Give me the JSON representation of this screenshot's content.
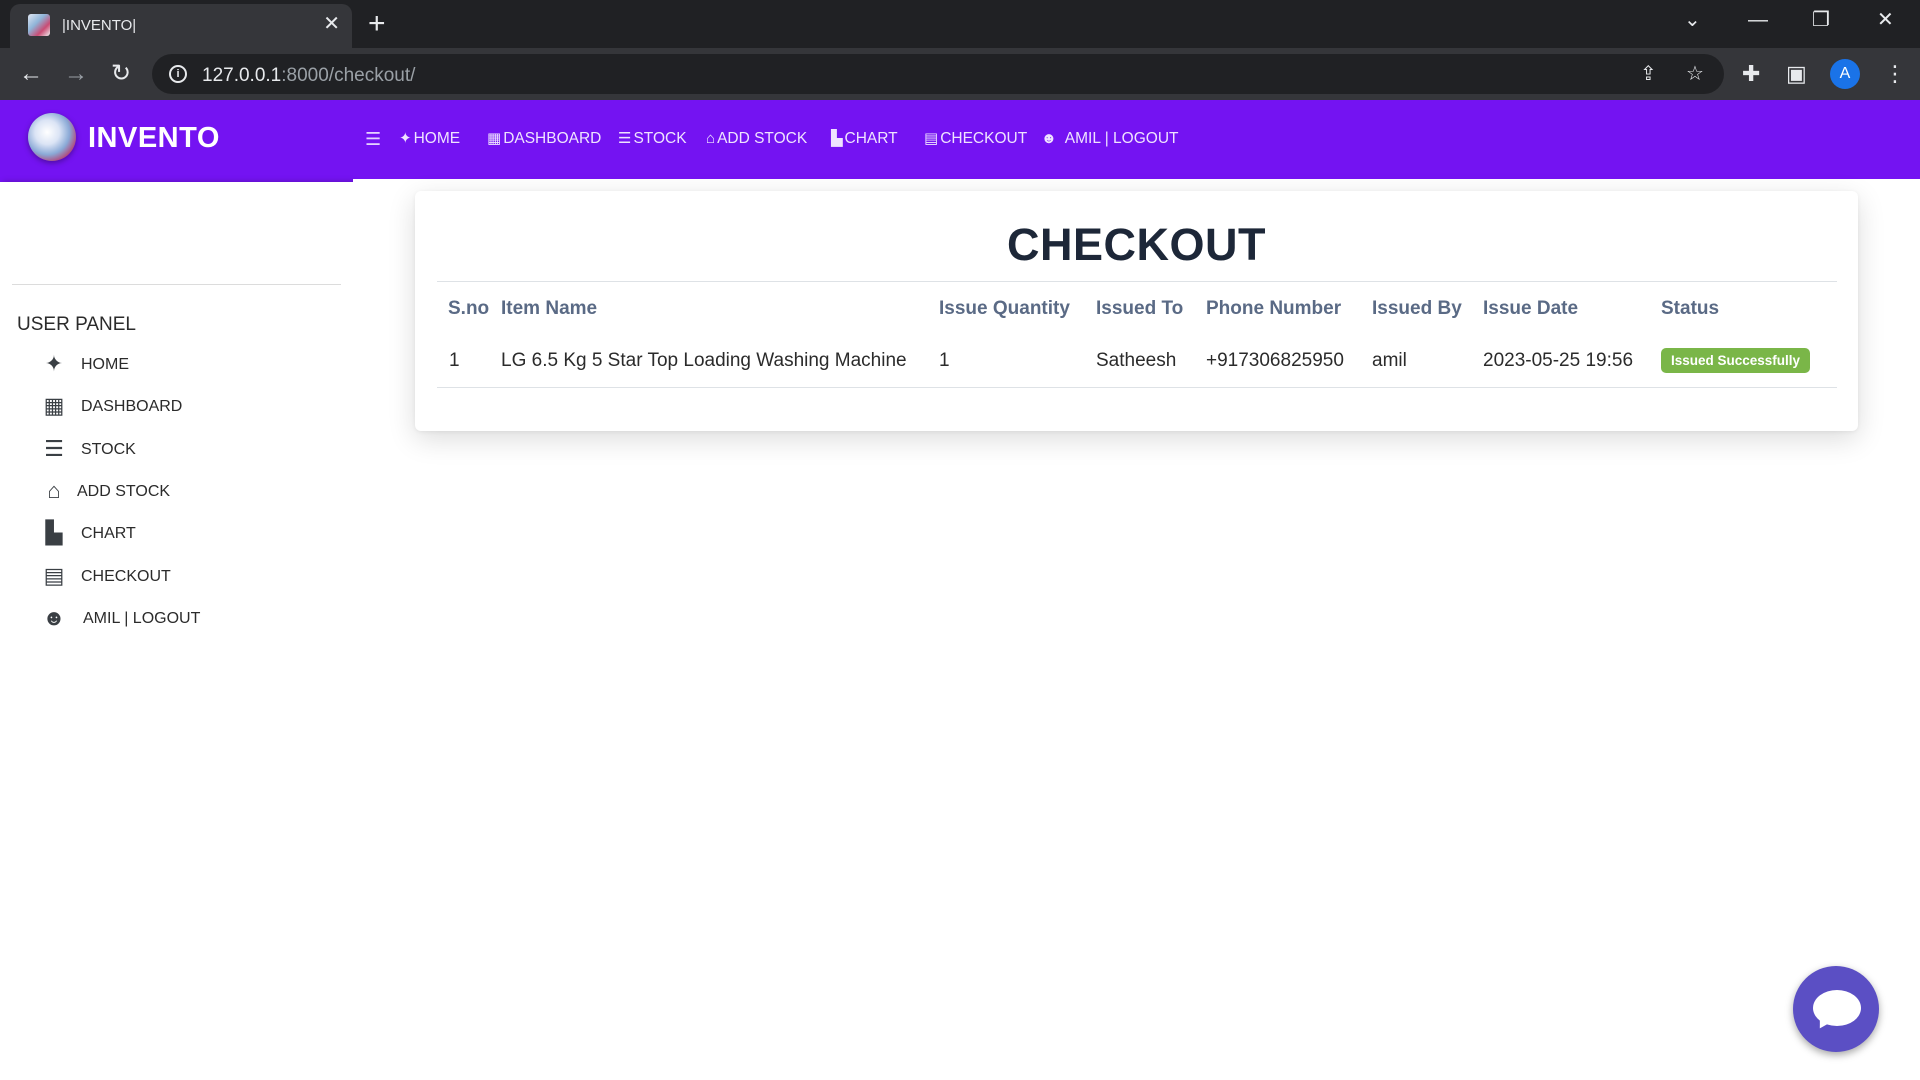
{
  "browser": {
    "tab_title": "|INVENTO|",
    "tab_close": "✕",
    "new_tab": "+",
    "url_host": "127.0.0.1",
    "url_rest": ":8000/checkout/",
    "profile_initial": "A"
  },
  "brand": {
    "name": "INVENTO",
    "color": "#7413f2"
  },
  "topnav": {
    "items": [
      {
        "label": "HOME",
        "icon": "puzzle-icon"
      },
      {
        "label": "DASHBOARD",
        "icon": "grid-icon"
      },
      {
        "label": "STOCK",
        "icon": "database-icon"
      },
      {
        "label": "ADD STOCK",
        "icon": "warehouse-icon"
      },
      {
        "label": "CHART",
        "icon": "chart-icon"
      },
      {
        "label": "CHECKOUT",
        "icon": "box-icon"
      },
      {
        "label": "AMIL | LOGOUT",
        "icon": "users-icon"
      }
    ]
  },
  "sidebar": {
    "panel_title": "USER PANEL",
    "items": [
      {
        "label": "HOME",
        "icon": "puzzle-icon"
      },
      {
        "label": "DASHBOARD",
        "icon": "grid-icon"
      },
      {
        "label": "STOCK",
        "icon": "database-icon"
      },
      {
        "label": "ADD STOCK",
        "icon": "warehouse-icon"
      },
      {
        "label": "CHART",
        "icon": "chart-icon"
      },
      {
        "label": "CHECKOUT",
        "icon": "box-icon"
      },
      {
        "label": "AMIL | LOGOUT",
        "icon": "users-icon"
      }
    ]
  },
  "checkout": {
    "title": "CHECKOUT",
    "columns": [
      "S.no",
      "Item Name",
      "Issue Quantity",
      "Issued To",
      "Phone Number",
      "Issued By",
      "Issue Date",
      "Status"
    ],
    "rows": [
      {
        "sno": "1",
        "item_name": "LG 6.5 Kg 5 Star Top Loading Washing Machine",
        "issue_quantity": "1",
        "issued_to": "Satheesh",
        "phone_number": "+917306825950",
        "issued_by": "amil",
        "issue_date": "2023-05-25 19:56",
        "status": "Issued Successfully",
        "status_color": "#7ab648"
      }
    ]
  }
}
